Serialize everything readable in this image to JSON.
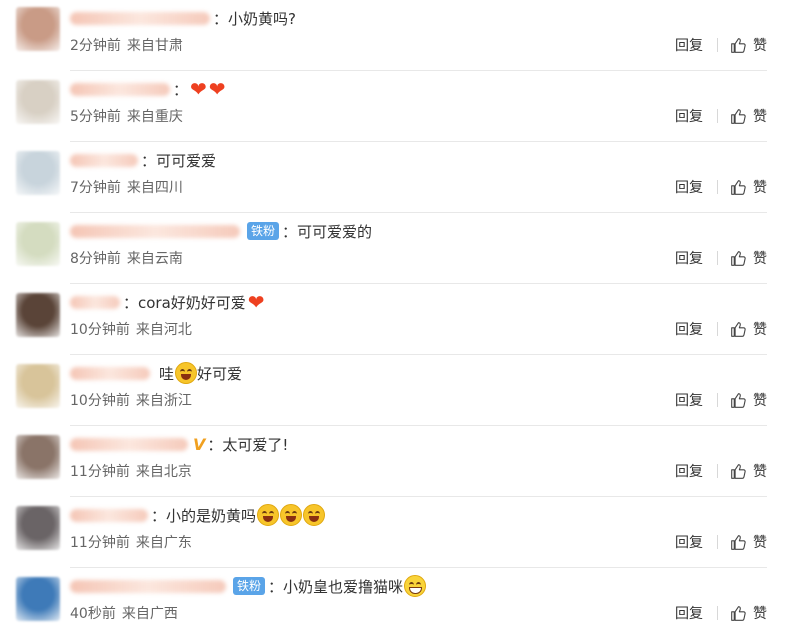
{
  "ui": {
    "reply_label": "回复",
    "like_label": "赞",
    "badge_label": "铁粉"
  },
  "comments": [
    {
      "text": "：小奶黄吗?",
      "time": "2分钟前",
      "location": "来自甘肃",
      "avatar_color": "#c99b86",
      "name_width": 140
    },
    {
      "text": "：",
      "time": "5分钟前",
      "location": "来自重庆",
      "avatar_color": "#d8d0c4",
      "name_width": 100,
      "trailing_icons": [
        "heart-icon",
        "heart-icon"
      ]
    },
    {
      "text": "：可可爱爱",
      "time": "7分钟前",
      "location": "来自四川",
      "avatar_color": "#c8d4dc",
      "name_width": 68
    },
    {
      "text": "：可可爱爱的",
      "time": "8分钟前",
      "location": "来自云南",
      "avatar_color": "#d4dcc0",
      "name_width": 170,
      "badge": true
    },
    {
      "text": "：cora好奶好可爱",
      "time": "10分钟前",
      "location": "来自河北",
      "avatar_color": "#5a4438",
      "name_width": 50,
      "trailing_icons": [
        "heart-icon"
      ]
    },
    {
      "text": "哇",
      "text2": "好可爱",
      "time": "10分钟前",
      "location": "来自浙江",
      "avatar_color": "#d8c49a",
      "name_width": 80,
      "middle_emoji": "laughing-emoji-icon"
    },
    {
      "text": "：太可爱了!",
      "time": "11分钟前",
      "location": "来自北京",
      "avatar_color": "#8a7468",
      "name_width": 118,
      "vmark": "V"
    },
    {
      "text": "：小的是奶黄吗",
      "time": "11分钟前",
      "location": "来自广东",
      "avatar_color": "#6a6466",
      "name_width": 78,
      "trailing_emojis": 3
    },
    {
      "text": "：小奶皇也爱撸猫咪",
      "time": "40秒前",
      "location": "来自广西",
      "avatar_color": "#3e7ab8",
      "name_width": 156,
      "badge": true,
      "trailing_grin": true
    }
  ]
}
